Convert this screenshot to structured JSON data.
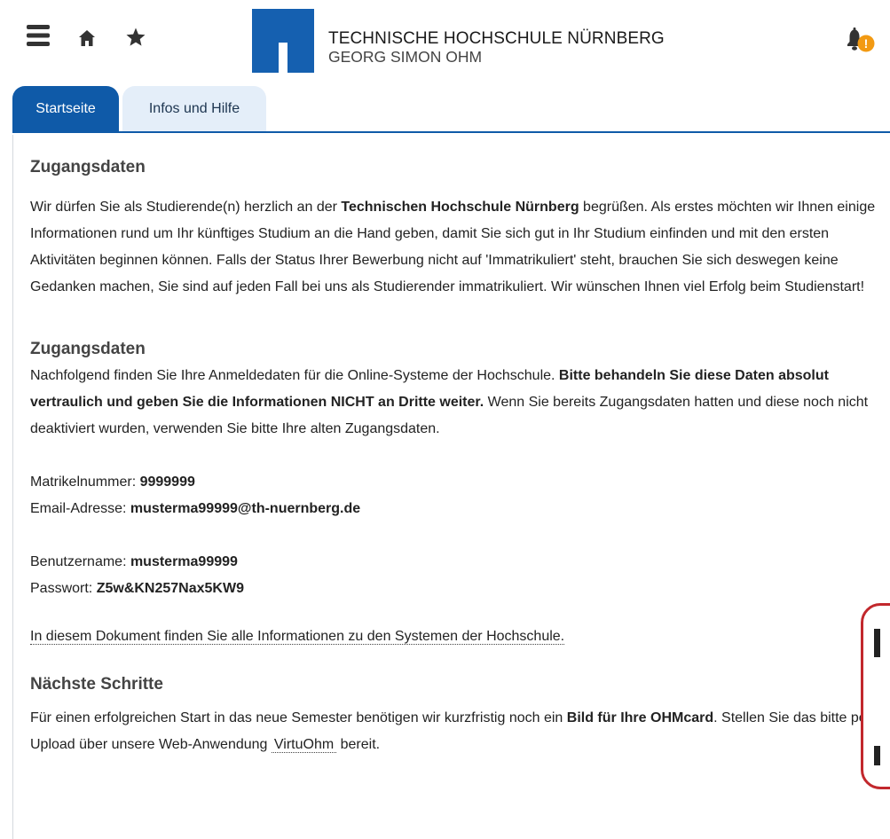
{
  "header": {
    "icons": [
      "menu-icon",
      "home-icon",
      "star-icon",
      "bell-icon",
      "alert-badge-icon"
    ],
    "logo_line1": "TECHNISCHE HOCHSCHULE NÜRNBERG",
    "logo_line2": "GEORG SIMON OHM",
    "badge_text": "!",
    "colors": {
      "brand": "#0f5aa8",
      "badge": "#f29a13",
      "tab_inactive_bg": "#e4eef9",
      "callout_border": "#c2282d"
    }
  },
  "tabs": [
    {
      "label": "Startseite",
      "active": true
    },
    {
      "label": "Infos und Hilfe",
      "active": false
    }
  ],
  "section1": {
    "heading": "Zugangsdaten",
    "text_a": "Wir dürfen Sie als Studierende(n) herzlich an der ",
    "bold": "Technischen Hochschule Nürnberg",
    "text_b": " begrüßen. Als erstes möchten wir Ihnen einige Informationen rund um Ihr künftiges Studium an die Hand geben, damit Sie sich gut in Ihr Studium einfinden und mit den ersten Aktivitäten beginnen können. Falls der Status Ihrer Bewerbung nicht auf 'Immatrikuliert' steht, brauchen Sie sich deswegen keine Gedanken machen, Sie sind auf jeden Fall bei uns als Studierender immatrikuliert. Wir wünschen Ihnen viel Erfolg beim Studienstart!"
  },
  "section2": {
    "heading": "Zugangsdaten",
    "text_a": "Nachfolgend finden Sie Ihre Anmeldedaten für die Online-Systeme der Hochschule. ",
    "bold": "Bitte behandeln Sie diese Daten absolut vertraulich und geben Sie die Informationen NICHT an Dritte weiter.",
    "text_b": " Wenn Sie bereits Zugangsdaten hatten und diese noch nicht deaktiviert wurden, verwenden Sie bitte Ihre alten Zugangsdaten."
  },
  "credentials": {
    "matrikel_label": "Matrikelnummer: ",
    "matrikel_value": "9999999",
    "email_label": "Email-Adresse: ",
    "email_value": "musterma99999@th-nuernberg.de",
    "user_label": "Benutzername: ",
    "user_value": "musterma99999",
    "pass_label": "Passwort: ",
    "pass_value": "Z5w&KN257Nax5KW9"
  },
  "doc_link": "In diesem Dokument finden Sie alle Informationen zu den Systemen der Hochschule.",
  "section3": {
    "heading": "Nächste Schritte",
    "text_a": "Für einen erfolgreichen Start in das neue Semester benötigen wir kurzfristig noch ein ",
    "bold": "Bild für Ihre OHMcard",
    "text_b": ". Stellen Sie das bitte per Upload über unsere Web-Anwendung ",
    "link": "VirtuOhm",
    "text_c": " bereit."
  }
}
